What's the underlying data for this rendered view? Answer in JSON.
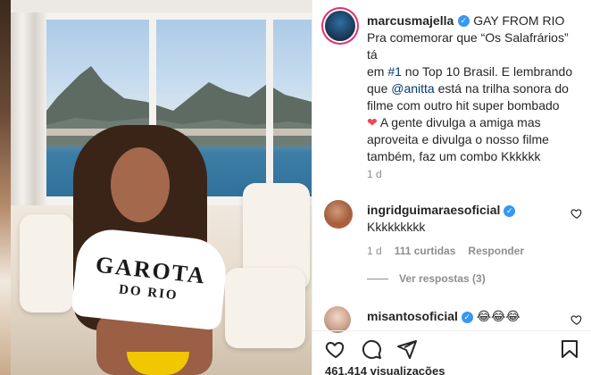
{
  "post": {
    "username": "marcusmajella",
    "verified_mark": "✓",
    "bio": "GAY FROM RIO",
    "caption": {
      "line1": "Pra comemorar que “Os Salafrários” tá",
      "line2_prefix": "em ",
      "line2_hashtag": "#1",
      "line2_suffix": " no Top 10 Brasil. E lembrando",
      "line3_prefix": "que ",
      "line3_mention": "@anitta",
      "line3_suffix": " está na trilha sonora do",
      "line4": "filme com outro hit super bombado",
      "line5_emoji": "❤",
      "line5_text": " A gente divulga a amiga mas",
      "line6": "aproveita e divulga o nosso filme",
      "line7": "também, faz um combo Kkkkkk"
    },
    "time": "1 d"
  },
  "shirt": {
    "line1": "GAROTA",
    "line2": "DO RIO"
  },
  "comments": [
    {
      "username": "ingridguimaraesoficial",
      "text": "Kkkkkkkkk",
      "time": "1 d",
      "likes": "111 curtidas",
      "reply_label": "Responder",
      "view_replies": "Ver respostas (3)"
    },
    {
      "username": "misantosoficial",
      "text": "😂😂😂"
    }
  ],
  "footer": {
    "views": "461.414 visualizações"
  },
  "icons": {
    "like": "heart-icon",
    "comment": "comment-icon",
    "share": "paper-plane-icon",
    "save": "bookmark-icon"
  },
  "colors": {
    "verified": "#3897f0",
    "link": "#00376b",
    "muted": "#8e8e8e",
    "heart": "#ed4956"
  }
}
